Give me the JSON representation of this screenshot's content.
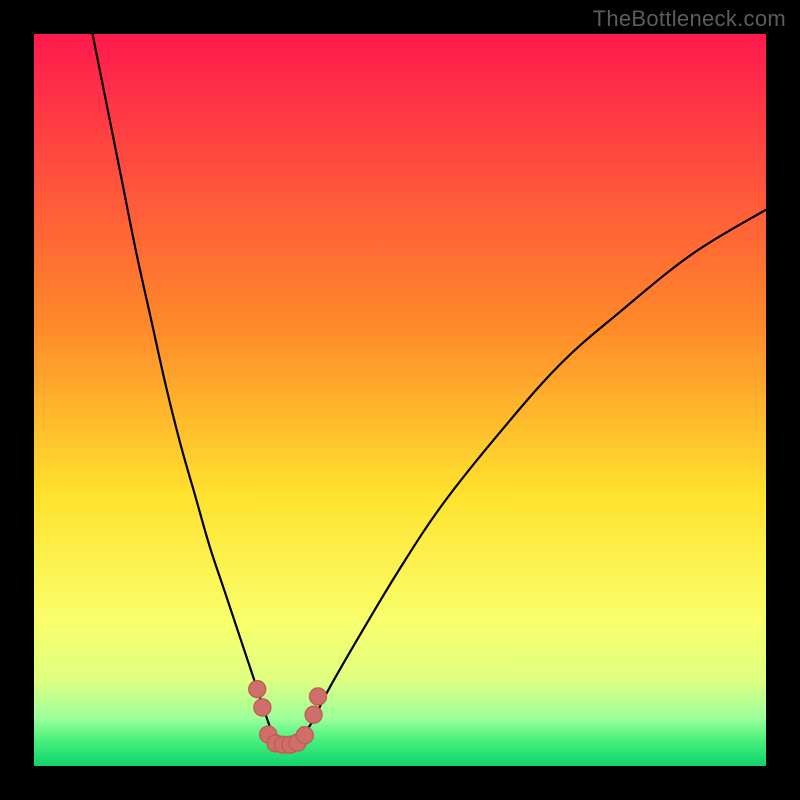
{
  "watermark": "TheBottleneck.com",
  "colors": {
    "frame": "#000000",
    "watermark_text": "#5c5c5c",
    "curve": "#000000",
    "marker_fill": "#cf6f6a",
    "marker_stroke": "#c45b55"
  },
  "chart_data": {
    "type": "line",
    "title": "",
    "xlabel": "",
    "ylabel": "",
    "xlim": [
      0,
      100
    ],
    "ylim": [
      0,
      100
    ],
    "grid": false,
    "legend": false,
    "background_gradient_stops": [
      {
        "offset": 0.0,
        "color": "#ff1a4e"
      },
      {
        "offset": 0.4,
        "color": "#ff8a2a"
      },
      {
        "offset": 0.63,
        "color": "#ffe22e"
      },
      {
        "offset": 0.8,
        "color": "#f9ff6a"
      },
      {
        "offset": 0.88,
        "color": "#e1ff80"
      },
      {
        "offset": 0.935,
        "color": "#9bff9b"
      },
      {
        "offset": 0.965,
        "color": "#48f07e"
      },
      {
        "offset": 1.0,
        "color": "#0fd36a"
      }
    ],
    "series": [
      {
        "name": "bottleneck-curve",
        "x": [
          8,
          10,
          12,
          14,
          16,
          18,
          20,
          22,
          24,
          26,
          28,
          30,
          31,
          32,
          33,
          34,
          35,
          36,
          38,
          40,
          44,
          50,
          56,
          64,
          72,
          80,
          90,
          100
        ],
        "y": [
          100,
          90,
          80,
          70,
          61,
          52,
          44,
          37,
          30,
          24,
          18,
          12,
          9,
          6,
          3.5,
          3,
          3,
          3.5,
          6,
          10,
          17,
          27,
          36,
          46,
          55,
          62,
          70,
          76
        ]
      }
    ],
    "markers": {
      "name": "highlighted-points",
      "x": [
        30.5,
        31.2,
        32.0,
        33.0,
        34.0,
        35.0,
        36.0,
        37.0,
        38.2,
        38.8
      ],
      "y": [
        10.5,
        8.0,
        4.3,
        3.1,
        2.9,
        2.9,
        3.2,
        4.2,
        7.0,
        9.5
      ]
    }
  }
}
